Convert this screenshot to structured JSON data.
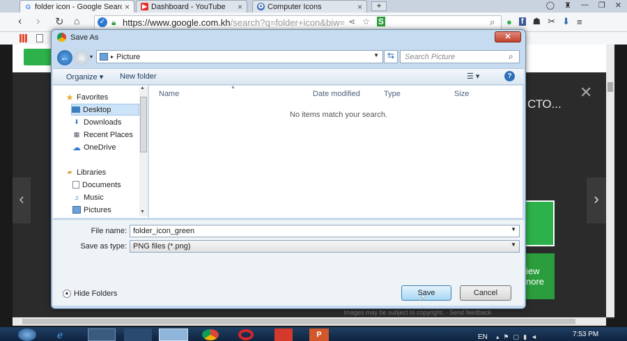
{
  "browser": {
    "tabs": [
      {
        "label": "folder icon - Google Searc",
        "icon": "google-icon"
      },
      {
        "label": "Dashboard - YouTube",
        "icon": "youtube-icon"
      },
      {
        "label": "Computer Icons",
        "icon": "computer-icons-icon"
      }
    ],
    "url_main": "https://www.google.com.kh",
    "url_rest": "/search?q=folder+icon&biw="
  },
  "dialog": {
    "title": "Save As",
    "close_label": "✕",
    "breadcrumb": "Picture",
    "search_placeholder": "Search Picture",
    "organize_label": "Organize ▾",
    "new_folder_label": "New folder",
    "nav": {
      "favorites_header": "Favorites",
      "favorites": [
        "Desktop",
        "Downloads",
        "Recent Places",
        "OneDrive"
      ],
      "libraries_header": "Libraries",
      "libraries": [
        "Documents",
        "Music",
        "Pictures"
      ]
    },
    "columns": [
      "Name",
      "Date modified",
      "Type",
      "Size"
    ],
    "empty_message": "No items match your search.",
    "file_name_label": "File name:",
    "file_name_value": "folder_icon_green",
    "save_as_type_label": "Save as type:",
    "save_as_type_value": "PNG files (*.png)",
    "hide_folders_label": "Hide Folders",
    "save_label": "Save",
    "cancel_label": "Cancel"
  },
  "page": {
    "heading_fragment": "СТО...",
    "green_text_line1": "iew",
    "green_text_line2": "nore",
    "copyright_fragment": "Images may be subject to copyright. · Send feedback"
  },
  "taskbar": {
    "language": "EN",
    "time": "7:53 PM"
  },
  "colors": {
    "accent_green": "#2db14b",
    "dialog_frame": "#c6dbef",
    "primary_button": "#a7d7f5"
  }
}
